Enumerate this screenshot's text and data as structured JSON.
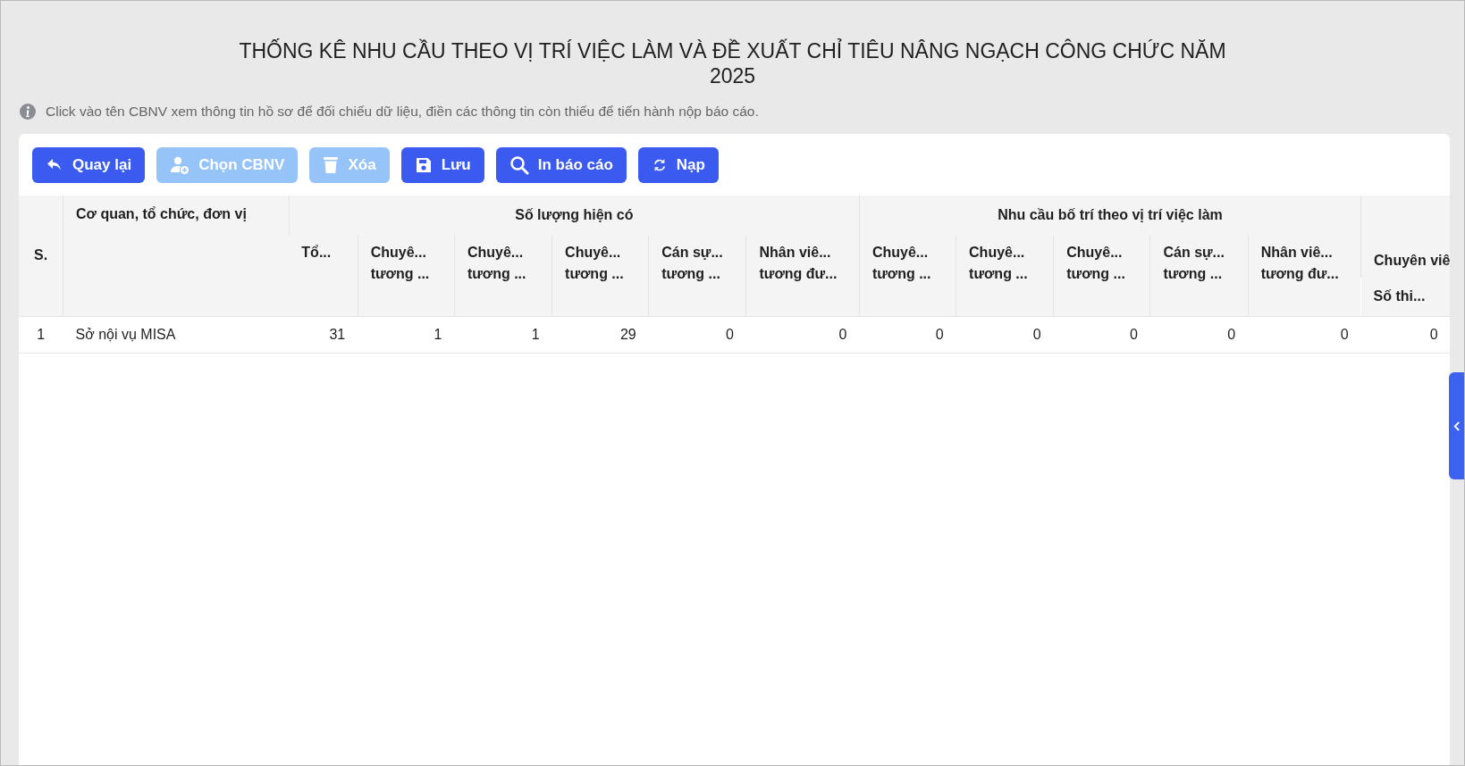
{
  "title": "THỐNG KÊ NHU CẦU THEO VỊ TRÍ VIỆC LÀM VÀ ĐỀ XUẤT CHỈ TIÊU NÂNG NGẠCH CÔNG CHỨC NĂM 2025",
  "info": "Click vào tên CBNV xem thông tin hồ sơ để đối chiếu dữ liệu, điền các thông tin còn thiếu để tiến hành nộp báo cáo.",
  "toolbar": [
    {
      "label": "Quay lại",
      "kind": "undo",
      "disabled": false
    },
    {
      "label": "Chọn CBNV",
      "kind": "user-add",
      "disabled": true
    },
    {
      "label": "Xóa",
      "kind": "trash",
      "disabled": true
    },
    {
      "label": "Lưu",
      "kind": "save",
      "disabled": false
    },
    {
      "label": "In báo cáo",
      "kind": "search",
      "disabled": false
    },
    {
      "label": "Nạp",
      "kind": "refresh",
      "disabled": false
    }
  ],
  "table": {
    "columns": [
      "S.",
      "Cơ quan, tổ chức, đơn vị"
    ],
    "groups": [
      {
        "label": "Số lượng hiện có",
        "columns": [
          "Tổ...",
          "Chuyê...\ntương ...",
          "Chuyê...\ntương ...",
          "Chuyê...\ntương ...",
          "Cán sự...\ntương ...",
          "Nhân viê...\ntương đư..."
        ]
      },
      {
        "label": "Nhu cầu bố trí theo vị trí việc làm",
        "columns": [
          "Chuyê...\ntương ...",
          "Chuyê...\ntương ...",
          "Chuyê...\ntương ...",
          "Cán sự...\ntương ...",
          "Nhân viê...\ntương đư..."
        ]
      },
      {
        "label": "Chuyên viê",
        "columns": [
          "Số thi..."
        ]
      }
    ],
    "rows": [
      {
        "cells": [
          "1",
          "Sở nội vụ MISA",
          "31",
          "1",
          "1",
          "29",
          "0",
          "0",
          "0",
          "0",
          "0",
          "0",
          "0",
          "0"
        ]
      }
    ]
  },
  "side_handle": {
    "expanded": false
  }
}
